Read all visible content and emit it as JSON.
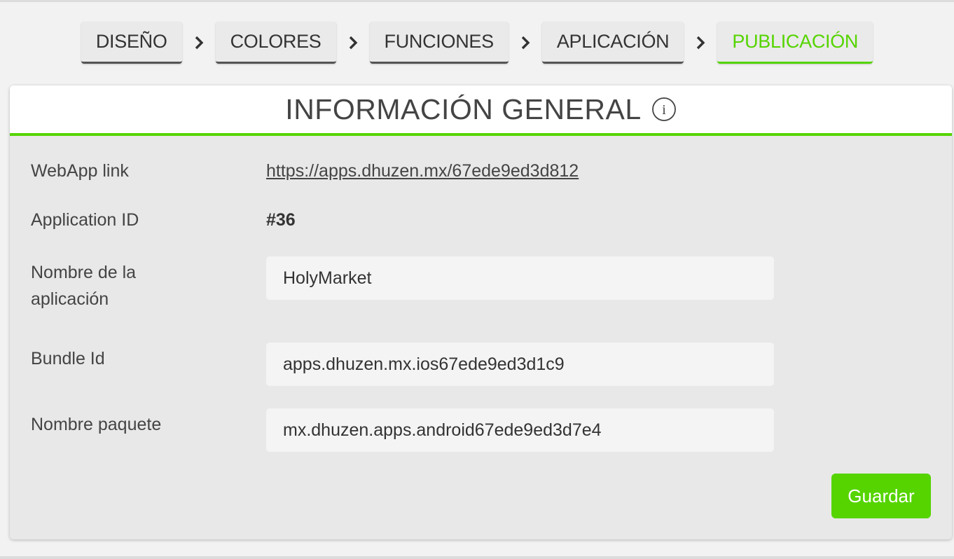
{
  "steps": [
    {
      "label": "DISEÑO",
      "active": false
    },
    {
      "label": "COLORES",
      "active": false
    },
    {
      "label": "FUNCIONES",
      "active": false
    },
    {
      "label": "APLICACIÓN",
      "active": false
    },
    {
      "label": "PUBLICACIÓN",
      "active": true
    }
  ],
  "card": {
    "title": "INFORMACIÓN GENERAL",
    "info_icon": "info-circle-icon"
  },
  "fields": {
    "webapp_link": {
      "label": "WebApp link",
      "value": "https://apps.dhuzen.mx/67ede9ed3d812"
    },
    "application_id": {
      "label": "Application ID",
      "value": "#36"
    },
    "app_name": {
      "label": "Nombre de la aplicación",
      "value": "HolyMarket"
    },
    "bundle_id": {
      "label": "Bundle Id",
      "value": "apps.dhuzen.mx.ios67ede9ed3d1c9"
    },
    "package_name": {
      "label": "Nombre paquete",
      "value": "mx.dhuzen.apps.android67ede9ed3d7e4"
    }
  },
  "save_button": {
    "label": "Guardar"
  },
  "colors": {
    "accent": "#55d400",
    "card_bg": "#e8e8e9",
    "field_bg": "#f4f4f4"
  }
}
